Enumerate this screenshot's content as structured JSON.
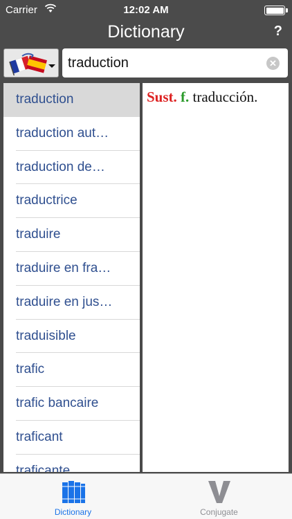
{
  "status": {
    "carrier": "Carrier",
    "time": "12:02 AM"
  },
  "header": {
    "title": "Dictionary",
    "help_label": "?"
  },
  "search": {
    "value": "traduction"
  },
  "list": [
    "traduction",
    "traduction aut…",
    "traduction de…",
    "traductrice",
    "traduire",
    "traduire en fra…",
    "traduire en jus…",
    "traduisible",
    "trafic",
    "trafic bancaire",
    "traficant",
    "traficante"
  ],
  "definition": {
    "pos": "Sust.",
    "gender": "f.",
    "text": "traducción."
  },
  "tabs": [
    {
      "label": "Dictionary",
      "icon": "books-icon"
    },
    {
      "label": "Conjugate",
      "icon": "v-icon"
    }
  ],
  "colors": {
    "accent": "#1a73e8",
    "pos": "#dd2222",
    "gender": "#2a9a2a",
    "link": "#2f4f8f"
  }
}
